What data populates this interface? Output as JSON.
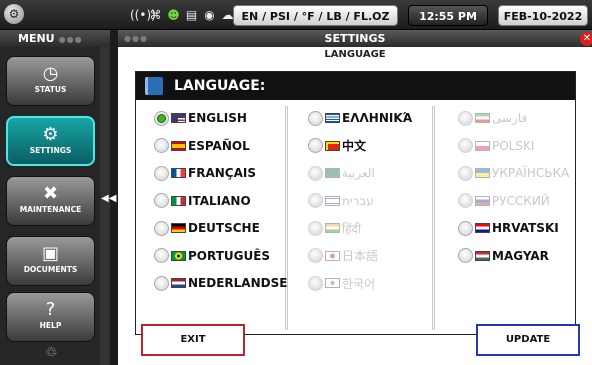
{
  "topbar": {
    "logo_icon": "gear-logo-icon",
    "status_icons": [
      "wifi-icon",
      "network-icon",
      "person-icon",
      "document-icon",
      "bug-icon",
      "cloud-icon"
    ],
    "units": "EN / PSI / °F / LB / FL.OZ",
    "time": "12:55 PM",
    "date": "FEB-10-2022"
  },
  "sidebar": {
    "title": "MENU",
    "items": [
      {
        "label": "STATUS",
        "icon": "status-gauge-icon"
      },
      {
        "label": "SETTINGS",
        "icon": "settings-gear-icon",
        "active": true
      },
      {
        "label": "MAINTENANCE",
        "icon": "tools-icon"
      },
      {
        "label": "DOCUMENTS",
        "icon": "document-icon"
      },
      {
        "label": "HELP",
        "icon": "help-icon"
      }
    ]
  },
  "panel": {
    "title": "SETTINGS",
    "subtitle": "LANGUAGE",
    "section_title": "LANGUAGE:",
    "languages": [
      [
        {
          "label": "ENGLISH",
          "flag": "us",
          "selected": true
        },
        {
          "label": "ESPAÑOL",
          "flag": "es"
        },
        {
          "label": "FRANÇAIS",
          "flag": "fr"
        },
        {
          "label": "ITALIANO",
          "flag": "it"
        },
        {
          "label": "DEUTSCHE",
          "flag": "de"
        },
        {
          "label": "PORTUGUÊS",
          "flag": "br"
        },
        {
          "label": "NEDERLANDSE",
          "flag": "nl"
        }
      ],
      [
        {
          "label": "ΕΛΛΗΝΙΚΆ",
          "flag": "gr"
        },
        {
          "label": "中文",
          "flag": "cn"
        },
        {
          "label": "العربية",
          "flag": "sa",
          "disabled": true
        },
        {
          "label": "עברית",
          "flag": "il",
          "disabled": true
        },
        {
          "label": "हिंदी",
          "flag": "in",
          "disabled": true
        },
        {
          "label": "日本語",
          "flag": "jp",
          "disabled": true
        },
        {
          "label": "한국어",
          "flag": "kr",
          "disabled": true
        }
      ],
      [
        {
          "label": "فارسی",
          "flag": "ir",
          "disabled": true
        },
        {
          "label": "POLSKI",
          "flag": "pl",
          "disabled": true
        },
        {
          "label": "УКРАЇНСЬКА",
          "flag": "ua",
          "disabled": true
        },
        {
          "label": "РУССКИЙ",
          "flag": "ru",
          "disabled": true
        },
        {
          "label": "HRVATSKI",
          "flag": "hr"
        },
        {
          "label": "MAGYAR",
          "flag": "hu"
        }
      ]
    ],
    "exit_label": "EXIT",
    "update_label": "UPDATE"
  }
}
